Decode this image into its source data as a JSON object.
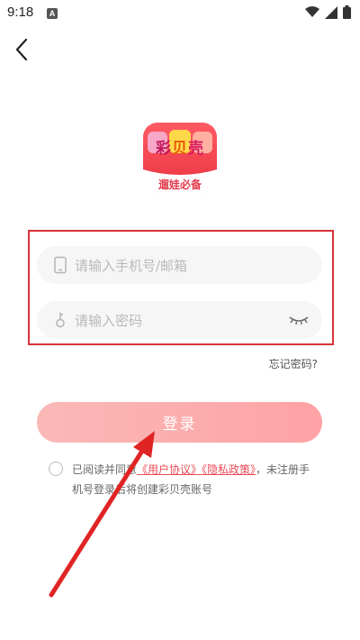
{
  "status_bar": {
    "time": "9:18",
    "app_badge": "A"
  },
  "logo": {
    "title_chars": [
      "彩",
      "贝",
      "壳"
    ],
    "slogan": "遛娃必备"
  },
  "form": {
    "account_placeholder": "请输入手机号/邮箱",
    "password_placeholder": "请输入密码",
    "forgot_label": "忘记密码?"
  },
  "login": {
    "label": "登录"
  },
  "agreement": {
    "prefix": "已阅读并同意",
    "user_agreement": "《用户协议》",
    "privacy_policy": "《隐私政策》",
    "suffix": "，未注册手机号登录后将创建彩贝壳账号"
  },
  "colors": {
    "accent": "#e94b57",
    "button_start": "#f9b9b7",
    "button_end": "#ffa2a5",
    "logo_bg": "#ef3f4f",
    "highlight_box": "#d93338"
  },
  "icons": {
    "back": "chevron-left-icon",
    "account": "phone-icon",
    "password": "key-icon",
    "visibility": "eye-closed-icon"
  }
}
